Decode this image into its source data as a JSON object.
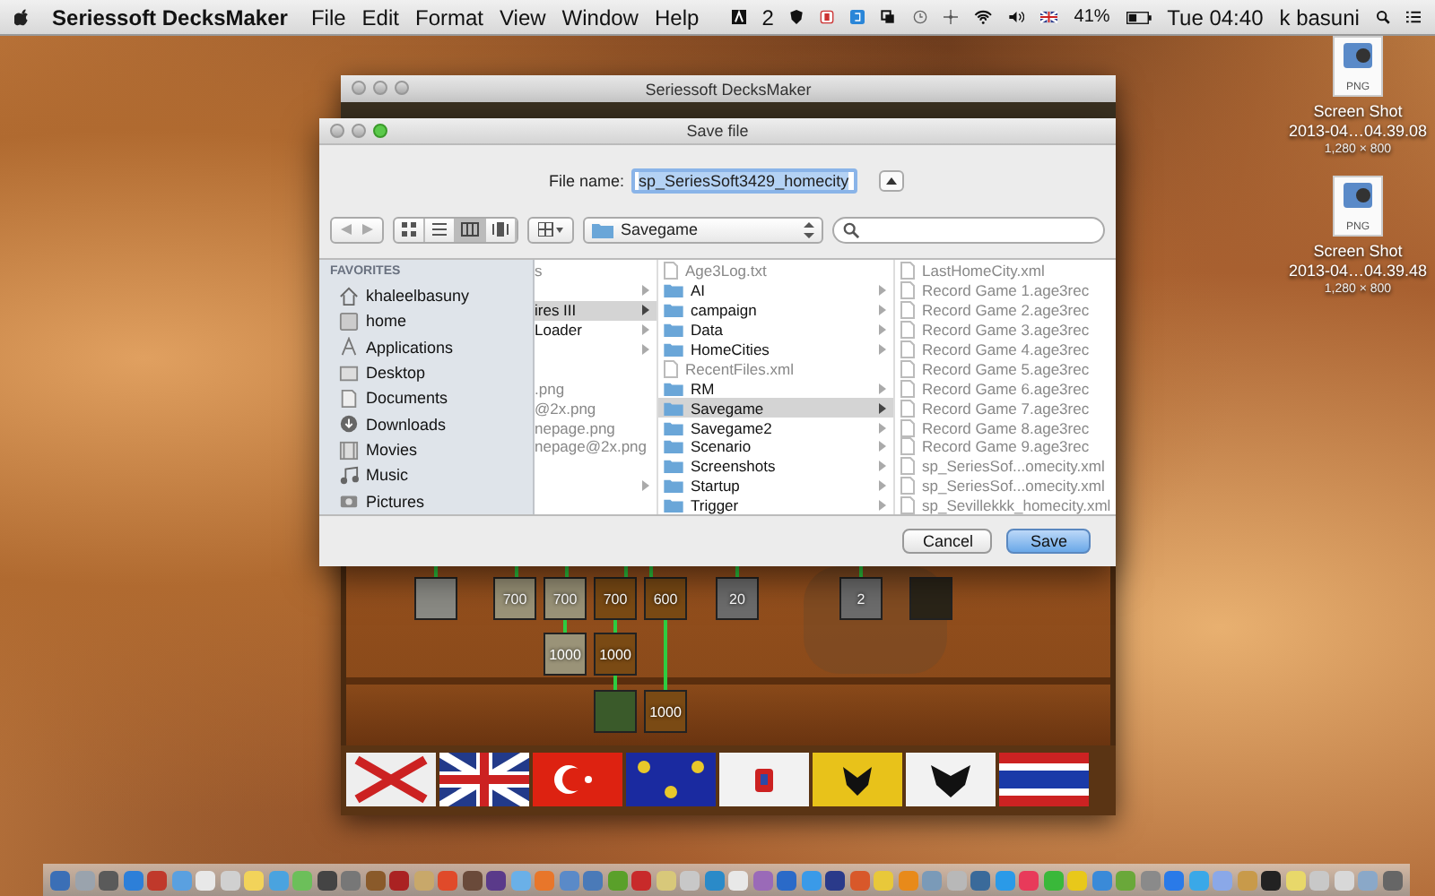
{
  "menu_bar": {
    "app_name": "Seriessoft DecksMaker",
    "menus": [
      "File",
      "Edit",
      "Format",
      "View",
      "Window",
      "Help"
    ],
    "adobe_count": "2",
    "battery": "41%",
    "clock": "Tue 04:40",
    "user": "k basuni"
  },
  "desktop_icons": [
    {
      "badge": "PNG",
      "title": "Screen Shot",
      "subtitle": "2013-04…04.39.08",
      "dimensions": "1,280 × 800"
    },
    {
      "badge": "PNG",
      "title": "Screen Shot",
      "subtitle": "2013-04…04.39.48",
      "dimensions": "1,280 × 800"
    }
  ],
  "app_window": {
    "title": "Seriessoft DecksMaker",
    "tile_rows": [
      [
        {
          "kind": "portrait"
        },
        {
          "kind": "crate",
          "label": "700"
        },
        {
          "kind": "crate",
          "label": "700"
        },
        {
          "kind": "chest",
          "label": "700"
        },
        {
          "kind": "chest",
          "label": "600"
        },
        {
          "kind": "animal",
          "label": "20"
        },
        {
          "kind": "animal",
          "label": "2"
        },
        {
          "kind": "balloon"
        }
      ],
      [
        {
          "kind": "crate",
          "label": "1000"
        },
        {
          "kind": "chest",
          "label": "1000"
        }
      ],
      [
        {
          "kind": "cloth"
        },
        {
          "kind": "chest",
          "label": "1000"
        }
      ]
    ]
  },
  "save_dialog": {
    "title": "Save file",
    "file_name_label": "File name:",
    "file_name": "sp_SeriesSoft3429_homecity",
    "view_modes": [
      {
        "kind": "icons",
        "selected": false
      },
      {
        "kind": "list",
        "selected": false
      },
      {
        "kind": "columns",
        "selected": true
      },
      {
        "kind": "coverflow",
        "selected": false
      }
    ],
    "location": "Savegame",
    "sidebar": {
      "heading": "FAVORITES",
      "items": [
        {
          "kind": "home",
          "label": "khaleelbasuny"
        },
        {
          "kind": "drive",
          "label": "home"
        },
        {
          "kind": "apps",
          "label": "Applications"
        },
        {
          "kind": "desktop",
          "label": "Desktop"
        },
        {
          "kind": "documents",
          "label": "Documents"
        },
        {
          "kind": "downloads",
          "label": "Downloads"
        },
        {
          "kind": "movies",
          "label": "Movies"
        },
        {
          "kind": "music",
          "label": "Music"
        },
        {
          "kind": "pictures",
          "label": "Pictures"
        }
      ]
    },
    "columns": [
      [
        {
          "kind": "file",
          "label": "s",
          "selected": false
        },
        {
          "kind": "folder",
          "selected": false
        },
        {
          "kind": "folder",
          "label": "ires III",
          "selected": true
        },
        {
          "kind": "folder",
          "label": "Loader",
          "selected": false
        },
        {
          "kind": "folder",
          "selected": false
        },
        {
          "kind": "blank"
        },
        {
          "kind": "file",
          "label": ".png",
          "selected": false
        },
        {
          "kind": "file",
          "label": "@2x.png",
          "selected": false
        },
        {
          "kind": "file",
          "label": "nepage.png",
          "selected": false
        },
        {
          "kind": "file",
          "label": "nepage@2x.png",
          "selected": false
        },
        {
          "kind": "blank"
        },
        {
          "kind": "folder",
          "selected": false
        }
      ],
      [
        {
          "kind": "file",
          "label": "Age3Log.txt",
          "selected": false
        },
        {
          "kind": "folder",
          "label": "AI",
          "selected": false
        },
        {
          "kind": "folder",
          "label": "campaign",
          "selected": false
        },
        {
          "kind": "folder",
          "label": "Data",
          "selected": false
        },
        {
          "kind": "folder",
          "label": "HomeCities",
          "selected": false
        },
        {
          "kind": "file",
          "label": "RecentFiles.xml",
          "selected": false
        },
        {
          "kind": "folder",
          "label": "RM",
          "selected": false
        },
        {
          "kind": "folder",
          "label": "Savegame",
          "selected": true
        },
        {
          "kind": "folder",
          "label": "Savegame2",
          "selected": false
        },
        {
          "kind": "folder",
          "label": "Scenario",
          "selected": false
        },
        {
          "kind": "folder",
          "label": "Screenshots",
          "selected": false
        },
        {
          "kind": "folder",
          "label": "Startup",
          "selected": false
        },
        {
          "kind": "folder",
          "label": "Trigger",
          "selected": false
        }
      ],
      [
        {
          "kind": "file",
          "label": "LastHomeCity.xml",
          "selected": false
        },
        {
          "kind": "file",
          "label": "Record Game 1.age3rec",
          "selected": false
        },
        {
          "kind": "file",
          "label": "Record Game 2.age3rec",
          "selected": false
        },
        {
          "kind": "file",
          "label": "Record Game 3.age3rec",
          "selected": false
        },
        {
          "kind": "file",
          "label": "Record Game 4.age3rec",
          "selected": false
        },
        {
          "kind": "file",
          "label": "Record Game 5.age3rec",
          "selected": false
        },
        {
          "kind": "file",
          "label": "Record Game 6.age3rec",
          "selected": false
        },
        {
          "kind": "file",
          "label": "Record Game 7.age3rec",
          "selected": false
        },
        {
          "kind": "file",
          "label": "Record Game 8.age3rec",
          "selected": false
        },
        {
          "kind": "file",
          "label": "Record Game 9.age3rec",
          "selected": false
        },
        {
          "kind": "file",
          "label": "sp_SeriesSof...omecity.xml",
          "selected": false
        },
        {
          "kind": "file",
          "label": "sp_SeriesSof...omecity.xml",
          "selected": false
        },
        {
          "kind": "file",
          "label": "sp_Sevillekkk_homecity.xml",
          "selected": false
        }
      ]
    ],
    "buttons": {
      "cancel": "Cancel",
      "save": "Save"
    }
  }
}
